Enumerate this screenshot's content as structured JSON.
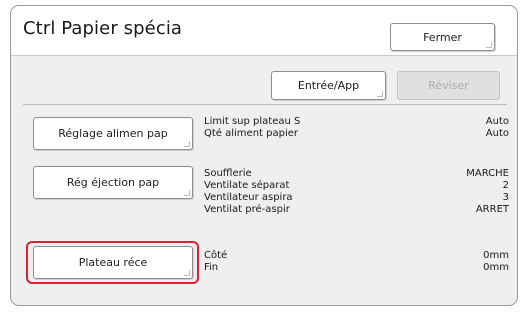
{
  "window": {
    "title": "Ctrl Papier spécia",
    "close_label": "Fermer"
  },
  "toolbar": {
    "entree_label": "Entrée/App",
    "reviser_label": "Réviser"
  },
  "sections": [
    {
      "button_label": "Réglage alimen pap",
      "rows": [
        {
          "label": "Limit sup plateau S",
          "value": "Auto"
        },
        {
          "label": "Qté aliment papier",
          "value": "Auto"
        }
      ]
    },
    {
      "button_label": "Rég éjection pap",
      "rows": [
        {
          "label": "Soufflerie",
          "value": "MARCHE"
        },
        {
          "label": "Ventilate séparat",
          "value": "2"
        },
        {
          "label": "Ventilateur aspira",
          "value": "3"
        },
        {
          "label": "Ventilat pré-aspir",
          "value": "ARRET"
        }
      ]
    },
    {
      "button_label": "Plateau réce",
      "highlighted": true,
      "rows": [
        {
          "label": "Côté",
          "value": "0mm"
        },
        {
          "label": "Fin",
          "value": "0mm"
        }
      ]
    }
  ],
  "colors": {
    "highlight": "#d9232d",
    "disabled_text": "#a9a9a9"
  }
}
